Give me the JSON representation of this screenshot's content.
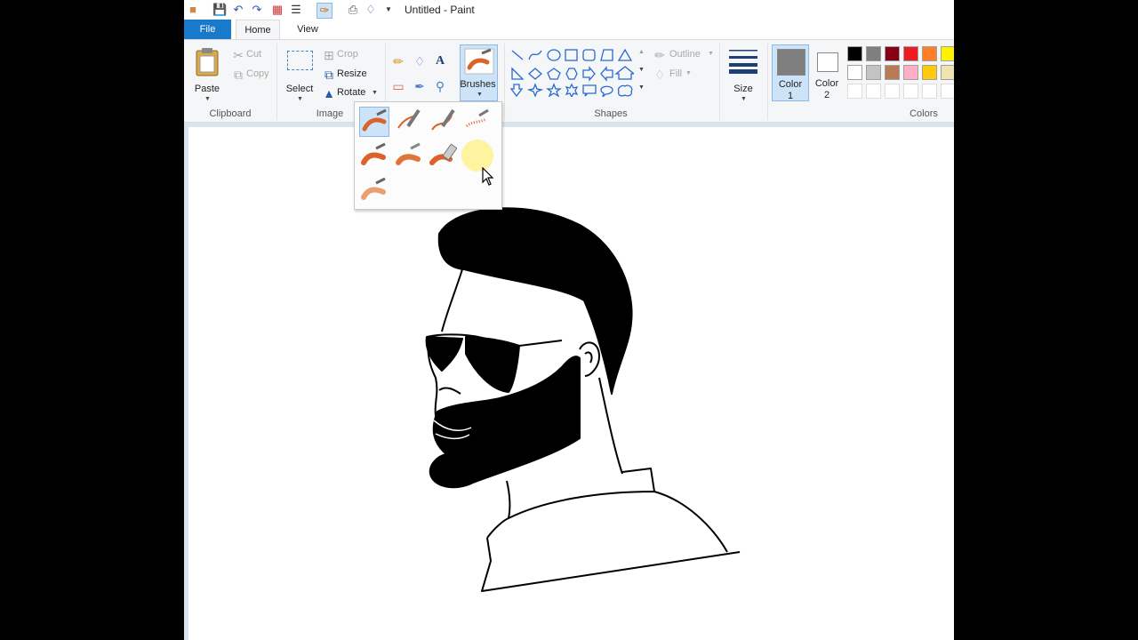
{
  "window": {
    "title": "Untitled - Paint"
  },
  "tabs": {
    "file": "File",
    "home": "Home",
    "view": "View"
  },
  "clipboard": {
    "paste": "Paste",
    "cut": "Cut",
    "copy": "Copy",
    "label": "Clipboard"
  },
  "image": {
    "select": "Select",
    "crop": "Crop",
    "resize": "Resize",
    "rotate": "Rotate",
    "label": "Image"
  },
  "tools": {
    "text_glyph": "A"
  },
  "brushes": {
    "label": "Brushes",
    "count": 9,
    "selected_index": 0
  },
  "shapes": {
    "outline": "Outline",
    "fill": "Fill",
    "label": "Shapes"
  },
  "size": {
    "label": "Size"
  },
  "colors": {
    "color1_label": "Color",
    "color1_num": "1",
    "color2_label": "Color",
    "color2_num": "2",
    "label": "Colors",
    "color1": "#7f7f7f",
    "color2": "#ffffff",
    "accent": "#1979ca",
    "palette_row1": [
      "#000000",
      "#7f7f7f",
      "#880015",
      "#ed1c24",
      "#ff7f27",
      "#fff200"
    ],
    "palette_row2": [
      "#ffffff",
      "#c3c3c3",
      "#b97a57",
      "#ffaec9",
      "#ffc90e",
      "#efe4b0"
    ]
  }
}
